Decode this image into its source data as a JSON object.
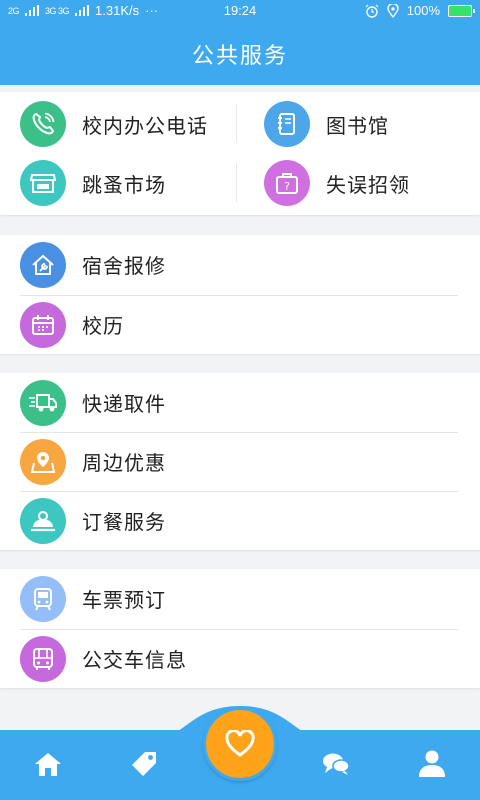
{
  "status_bar": {
    "network_speed": "1.31K/s",
    "dots": "···",
    "time": "19:24",
    "battery_percent": "100%",
    "signal_labels": [
      "2G",
      "3G 3G"
    ]
  },
  "header": {
    "title": "公共服务"
  },
  "sections": {
    "grid": [
      {
        "label": "校内办公电话",
        "icon": "phone-icon",
        "color": "#3cc08a"
      },
      {
        "label": "图书馆",
        "icon": "notebook-icon",
        "color": "#4ea6ea"
      },
      {
        "label": "跳蚤市场",
        "icon": "store-icon",
        "color": "#3ec7c0"
      },
      {
        "label": "失误招领",
        "icon": "lost-bag-icon",
        "color": "#d070e0"
      }
    ],
    "group2": [
      {
        "label": "宿舍报修",
        "icon": "wrench-house-icon",
        "color": "#4a90e2"
      },
      {
        "label": "校历",
        "icon": "calendar-icon",
        "color": "#c669dc"
      }
    ],
    "group3": [
      {
        "label": "快递取件",
        "icon": "truck-icon",
        "color": "#3cc08a"
      },
      {
        "label": "周边优惠",
        "icon": "map-pin-icon",
        "color": "#f8a740"
      },
      {
        "label": "订餐服务",
        "icon": "food-service-icon",
        "color": "#3ec7c0"
      }
    ],
    "group4": [
      {
        "label": "车票预订",
        "icon": "train-icon",
        "color": "#93bef8"
      },
      {
        "label": "公交车信息",
        "icon": "bus-icon",
        "color": "#c669dc"
      }
    ]
  },
  "tabbar": {
    "items": [
      "home-icon",
      "tag-icon",
      "heart-icon",
      "chat-icon",
      "user-icon"
    ],
    "fab_color": "#ffa31a",
    "bar_color": "#3fa9ef"
  }
}
